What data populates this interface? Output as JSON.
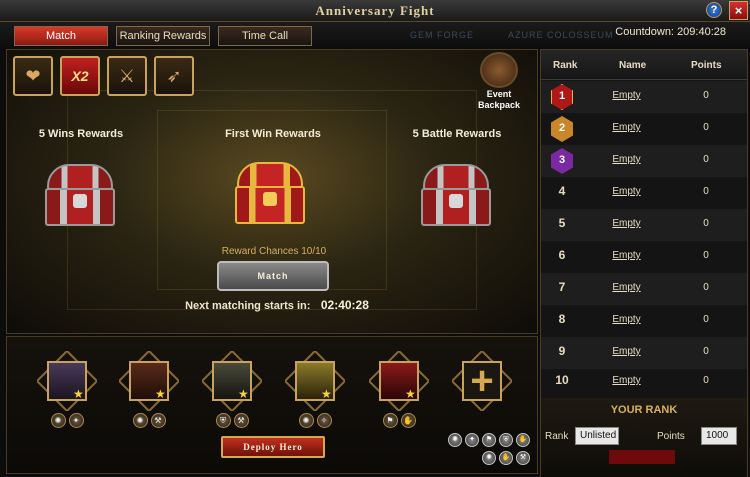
{
  "window": {
    "title": "Anniversary Fight",
    "help_label": "?",
    "close_label": "×"
  },
  "tabs": [
    {
      "label": "Match",
      "active": true
    },
    {
      "label": "Ranking Rewards",
      "active": false
    },
    {
      "label": "Time Call",
      "active": false
    }
  ],
  "watermarks": [
    "GEM FORGE",
    "AZURE COLOSSEUM"
  ],
  "countdown": {
    "label": "Countdown:",
    "value": "209:40:28"
  },
  "buffs": [
    {
      "icon": "heart-icon",
      "glyph": "❤"
    },
    {
      "icon": "x2-icon",
      "glyph": "X2"
    },
    {
      "icon": "sword-icon",
      "glyph": "⚔"
    },
    {
      "icon": "speed-boot-icon",
      "glyph": "➶"
    }
  ],
  "backpack": {
    "label_line1": "Event",
    "label_line2": "Backpack"
  },
  "rewards": [
    {
      "title": "5 Wins Rewards",
      "chest": "silver"
    },
    {
      "title": "First Win Rewards",
      "chest": "gold"
    },
    {
      "title": "5 Battle Rewards",
      "chest": "silver"
    }
  ],
  "reward_chances": "Reward Chances 10/10",
  "match_button": "Match",
  "next_match": {
    "label": "Next matching starts in:",
    "time": "02:40:28"
  },
  "heroes": [
    {
      "name": "hero-1",
      "color": "#4a3a5a",
      "stars": 1,
      "skills": [
        "✺",
        "✦"
      ]
    },
    {
      "name": "hero-2",
      "color": "#5a2a1a",
      "stars": 1,
      "skills": [
        "✺",
        "⚒"
      ]
    },
    {
      "name": "hero-3",
      "color": "#3a3a2a",
      "stars": 1,
      "skills": [
        "⛨",
        "⚒"
      ]
    },
    {
      "name": "hero-4",
      "color": "#6a5a1a",
      "stars": 1,
      "skills": [
        "✺",
        "✧"
      ]
    },
    {
      "name": "hero-5",
      "color": "#6a1a1a",
      "stars": 1,
      "skills": [
        "⚑",
        "✋"
      ]
    }
  ],
  "add_slot_glyph": "+",
  "deploy_button": "Deploy Hero",
  "filters": [
    "✺",
    "✦",
    "⚑",
    "⛨",
    "✋",
    "✺",
    "✋",
    "⚒"
  ],
  "ranking": {
    "headers": {
      "rank": "Rank",
      "name": "Name",
      "points": "Points"
    },
    "rows": [
      {
        "rank": "1",
        "name": "Empty",
        "points": "0",
        "medal": "#b01818"
      },
      {
        "rank": "2",
        "name": "Empty",
        "points": "0",
        "medal": "#c8882a"
      },
      {
        "rank": "3",
        "name": "Empty",
        "points": "0",
        "medal": "#7a2aa0"
      },
      {
        "rank": "4",
        "name": "Empty",
        "points": "0"
      },
      {
        "rank": "5",
        "name": "Empty",
        "points": "0"
      },
      {
        "rank": "6",
        "name": "Empty",
        "points": "0"
      },
      {
        "rank": "7",
        "name": "Empty",
        "points": "0"
      },
      {
        "rank": "8",
        "name": "Empty",
        "points": "0"
      },
      {
        "rank": "9",
        "name": "Empty",
        "points": "0"
      },
      {
        "rank": "10",
        "name": "Empty",
        "points": "0"
      }
    ]
  },
  "your_rank": {
    "title": "YOUR RANK",
    "rank_label": "Rank",
    "rank_value": "Unlisted",
    "points_label": "Points",
    "points_value": "1000"
  }
}
